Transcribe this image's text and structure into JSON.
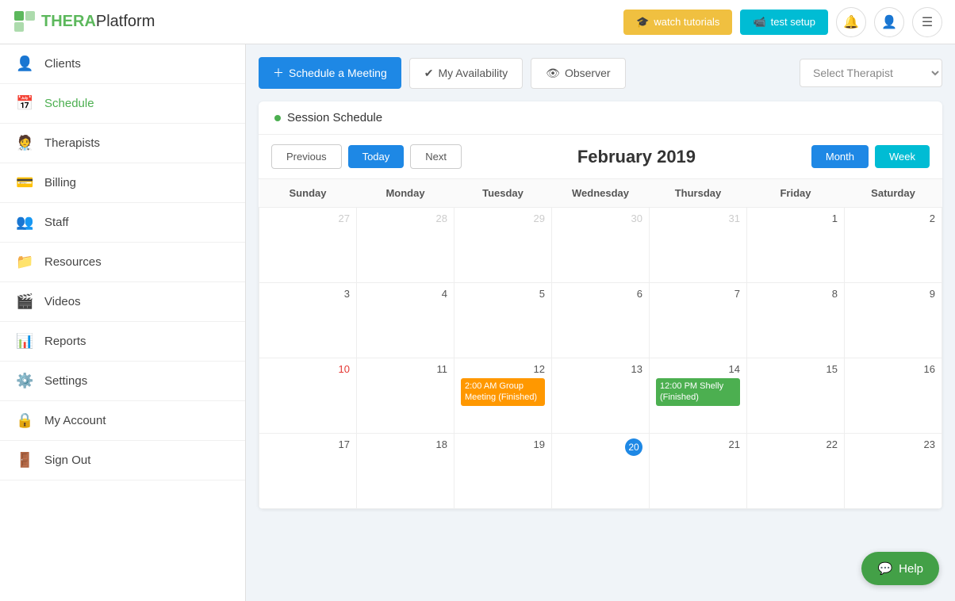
{
  "app": {
    "name": "THERAPlatform"
  },
  "navbar": {
    "watch_tutorials_label": "watch tutorials",
    "test_setup_label": "test setup",
    "watch_icon": "🎓",
    "video_icon": "📹"
  },
  "sidebar": {
    "items": [
      {
        "id": "clients",
        "label": "Clients",
        "icon": "👤"
      },
      {
        "id": "schedule",
        "label": "Schedule",
        "icon": "📅"
      },
      {
        "id": "therapists",
        "label": "Therapists",
        "icon": "🧑‍⚕️"
      },
      {
        "id": "billing",
        "label": "Billing",
        "icon": "💳"
      },
      {
        "id": "staff",
        "label": "Staff",
        "icon": "👥"
      },
      {
        "id": "resources",
        "label": "Resources",
        "icon": "📁"
      },
      {
        "id": "videos",
        "label": "Videos",
        "icon": "🎬"
      },
      {
        "id": "reports",
        "label": "Reports",
        "icon": "📊"
      },
      {
        "id": "settings",
        "label": "Settings",
        "icon": "⚙️"
      },
      {
        "id": "my-account",
        "label": "My Account",
        "icon": "🔒"
      },
      {
        "id": "sign-out",
        "label": "Sign Out",
        "icon": "🚪"
      }
    ]
  },
  "action_bar": {
    "schedule_meeting_label": "Schedule a Meeting",
    "my_availability_label": "My Availability",
    "observer_label": "Observer",
    "select_therapist_placeholder": "Select Therapist"
  },
  "calendar": {
    "session_schedule_label": "Session Schedule",
    "previous_label": "Previous",
    "today_label": "Today",
    "next_label": "Next",
    "month_label": "Month",
    "week_label": "Week",
    "title": "February 2019",
    "days_of_week": [
      "Sunday",
      "Monday",
      "Tuesday",
      "Wednesday",
      "Thursday",
      "Friday",
      "Saturday"
    ],
    "weeks": [
      [
        {
          "num": "27",
          "faded": true,
          "events": []
        },
        {
          "num": "28",
          "faded": true,
          "events": []
        },
        {
          "num": "29",
          "faded": true,
          "events": []
        },
        {
          "num": "30",
          "faded": true,
          "events": []
        },
        {
          "num": "31",
          "faded": true,
          "events": []
        },
        {
          "num": "1",
          "faded": false,
          "events": []
        },
        {
          "num": "2",
          "faded": false,
          "events": []
        }
      ],
      [
        {
          "num": "3",
          "faded": false,
          "events": []
        },
        {
          "num": "4",
          "faded": false,
          "events": []
        },
        {
          "num": "5",
          "faded": false,
          "events": []
        },
        {
          "num": "6",
          "faded": false,
          "events": []
        },
        {
          "num": "7",
          "faded": false,
          "events": []
        },
        {
          "num": "8",
          "faded": false,
          "events": []
        },
        {
          "num": "9",
          "faded": false,
          "events": []
        }
      ],
      [
        {
          "num": "10",
          "faded": false,
          "red": true,
          "events": []
        },
        {
          "num": "11",
          "faded": false,
          "events": []
        },
        {
          "num": "12",
          "faded": false,
          "events": [
            {
              "type": "orange",
              "text": "2:00 AM Group Meeting (Finished)"
            }
          ]
        },
        {
          "num": "13",
          "faded": false,
          "events": []
        },
        {
          "num": "14",
          "faded": false,
          "events": [
            {
              "type": "green",
              "text": "12:00 PM Shelly (Finished)"
            }
          ]
        },
        {
          "num": "15",
          "faded": false,
          "events": []
        },
        {
          "num": "16",
          "faded": false,
          "events": []
        }
      ],
      [
        {
          "num": "17",
          "faded": false,
          "events": []
        },
        {
          "num": "18",
          "faded": false,
          "events": []
        },
        {
          "num": "19",
          "faded": false,
          "events": []
        },
        {
          "num": "20",
          "faded": false,
          "today": true,
          "events": []
        },
        {
          "num": "21",
          "faded": false,
          "events": []
        },
        {
          "num": "22",
          "faded": false,
          "events": []
        },
        {
          "num": "23",
          "faded": false,
          "events": []
        }
      ]
    ]
  },
  "help": {
    "label": "Help"
  }
}
